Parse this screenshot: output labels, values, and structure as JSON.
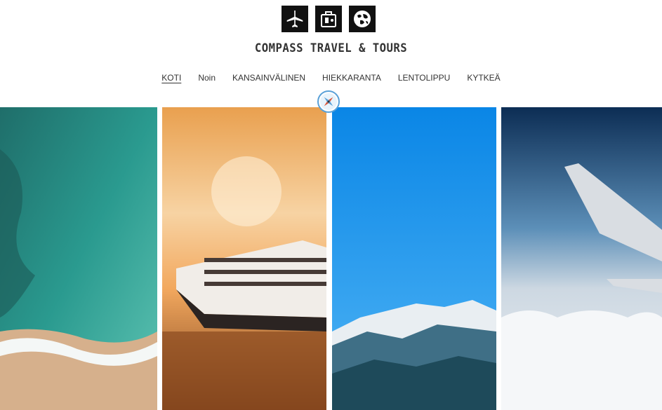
{
  "header": {
    "logo_icons": [
      "airplane-icon",
      "suitcase-icon",
      "globe-icon"
    ],
    "brand": "COMPASS TRAVEL & TOURS"
  },
  "nav": {
    "items": [
      {
        "label": "KOTI",
        "active": true
      },
      {
        "label": "Noin",
        "active": false
      },
      {
        "label": "KANSAINVÄLINEN",
        "active": false
      },
      {
        "label": "HIEKKARANTA",
        "active": false
      },
      {
        "label": "LENTOLIPPU",
        "active": false
      },
      {
        "label": "KYTKEÄ",
        "active": false
      }
    ]
  },
  "divider_icon": "compass-icon",
  "gallery": {
    "panels": [
      {
        "name": "beach-aerial-image"
      },
      {
        "name": "cruise-ship-image"
      },
      {
        "name": "snowy-mountains-image"
      },
      {
        "name": "airplane-wing-image"
      }
    ]
  },
  "colors": {
    "accent": "#5aa1d8",
    "text": "#333333",
    "logo_bg": "#111111"
  }
}
